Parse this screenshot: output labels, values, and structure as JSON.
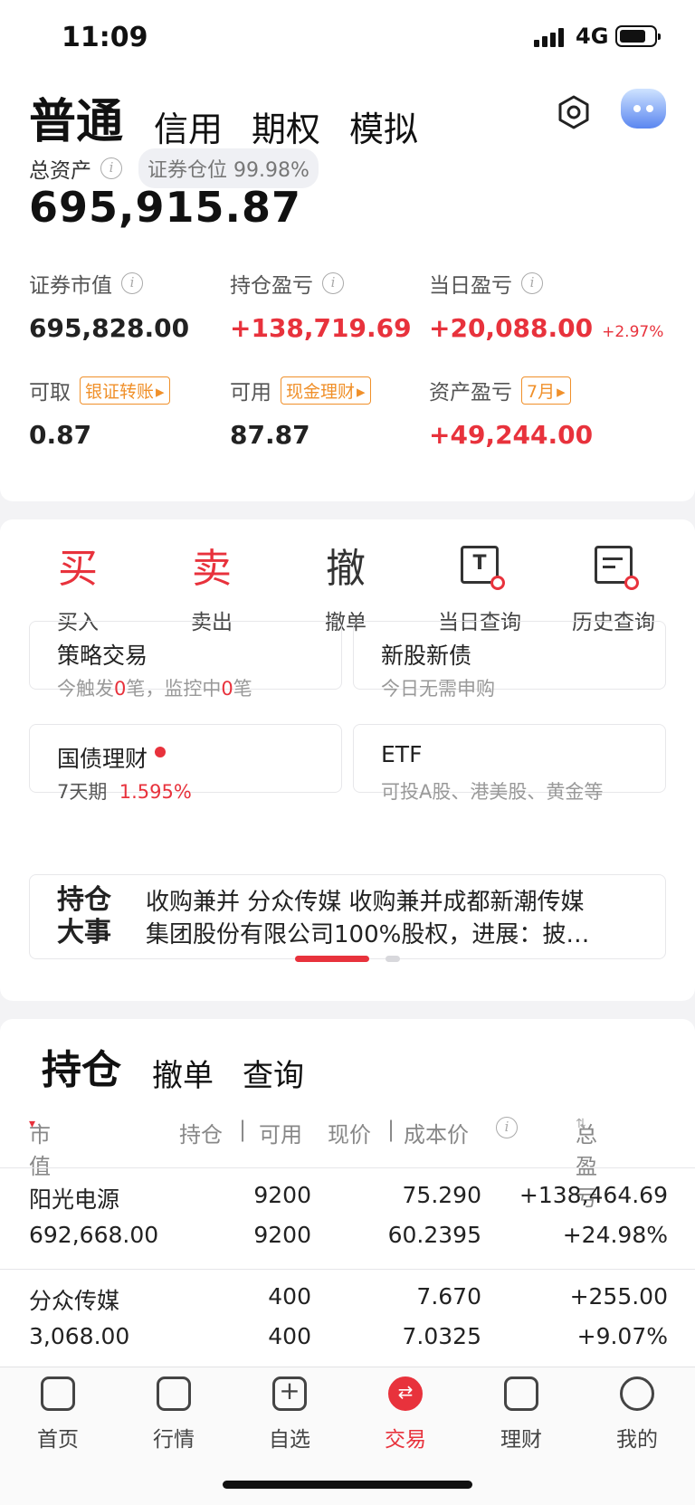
{
  "status": {
    "time": "11:09",
    "network": "4G"
  },
  "account_tabs": [
    "普通",
    "信用",
    "期权",
    "模拟"
  ],
  "summary": {
    "total_label": "总资产",
    "position_pill": "证券仓位 99.98%",
    "total_value": "695,915.87",
    "market_value_label": "证券市值",
    "market_value": "695,828.00",
    "holding_pl_label": "持仓盈亏",
    "holding_pl": "+138,719.69",
    "daily_pl_label": "当日盈亏",
    "daily_pl": "+20,088.00",
    "daily_pl_pct": "+2.97%",
    "withdrawable_label": "可取",
    "transfer_tag": "银证转账",
    "withdrawable": "0.87",
    "available_label": "可用",
    "cash_tag": "现金理财",
    "available": "87.87",
    "asset_pl_label": "资产盈亏",
    "month_tag": "7月",
    "asset_pl": "+49,244.00"
  },
  "actions": [
    {
      "glyph": "买",
      "label": "买入"
    },
    {
      "glyph": "卖",
      "label": "卖出"
    },
    {
      "glyph": "撤",
      "label": "撤单"
    },
    {
      "glyph": "T",
      "label": "当日查询"
    },
    {
      "glyph": "",
      "label": "历史查询"
    }
  ],
  "features": {
    "strategy": {
      "title": "策略交易",
      "sub_a": "今触发",
      "count_a": "0",
      "sub_b": "笔，监控中",
      "count_b": "0",
      "sub_c": "笔"
    },
    "ipo": {
      "title": "新股新债",
      "sub": "今日无需申购"
    },
    "bond": {
      "title": "国债理财",
      "period": "7天期",
      "rate": "1.595%"
    },
    "etf": {
      "title": "ETF",
      "sub": "可投A股、港美股、黄金等"
    }
  },
  "news": {
    "title_1": "持仓",
    "title_2": "大事",
    "line_1": "收购兼并 分众传媒 收购兼并成都新潮传媒",
    "line_2": "集团股份有限公司100%股权，进展：披…"
  },
  "holdings": {
    "tabs": [
      "持仓",
      "撤单",
      "查询"
    ],
    "columns": {
      "market": "市值",
      "position": "持仓",
      "sep1": "|",
      "available": "可用",
      "price": "现价",
      "sep2": "|",
      "cost": "成本价",
      "pl": "总盈亏"
    },
    "rows": [
      {
        "name": "阳光电源",
        "market_value": "692,668.00",
        "qty": "9200",
        "avail": "9200",
        "price": "75.290",
        "cost": "60.2395",
        "pl": "+138,464.69",
        "pl_pct": "+24.98%"
      },
      {
        "name": "分众传媒",
        "market_value": "3,068.00",
        "qty": "400",
        "avail": "400",
        "price": "7.670",
        "cost": "7.0325",
        "pl": "+255.00",
        "pl_pct": "+9.07%"
      }
    ]
  },
  "nav": [
    "首页",
    "行情",
    "自选",
    "交易",
    "理财",
    "我的"
  ],
  "colors": {
    "accent": "#e8323c",
    "tag": "#f0902a"
  }
}
